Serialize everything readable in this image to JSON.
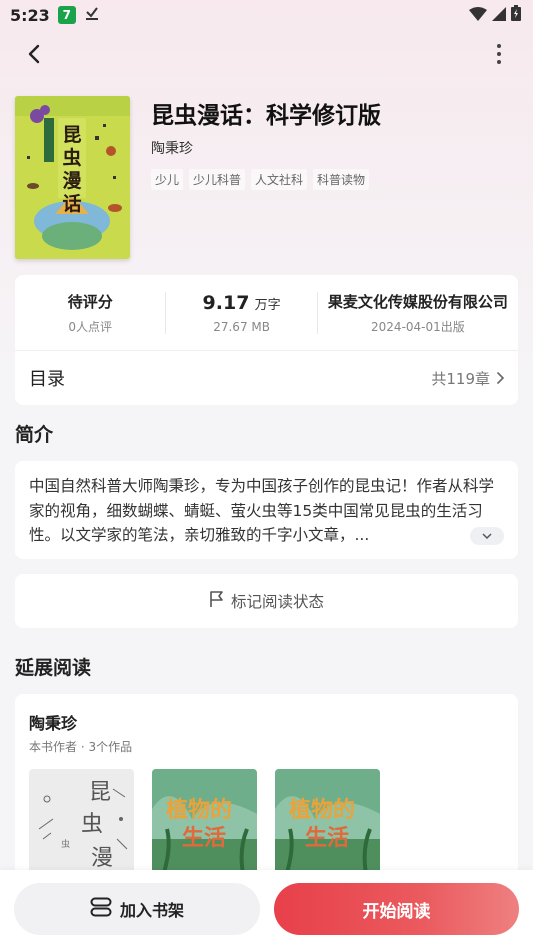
{
  "status_bar": {
    "time": "5:23",
    "app_badge": "7"
  },
  "book": {
    "title": "昆虫漫话：科学修订版",
    "author": "陶秉珍",
    "tags": [
      "少儿",
      "少儿科普",
      "人文社科",
      "科普读物"
    ],
    "cover_text": "昆虫漫话"
  },
  "stats": {
    "rating_label": "待评分",
    "rating_sub": "0人点评",
    "word_count": "9.17",
    "word_unit": "万字",
    "file_size": "27.67 MB",
    "publisher": "果麦文化传媒股份有限公司",
    "publish_date": "2024-04-01出版"
  },
  "toc": {
    "label": "目录",
    "count": "共119章"
  },
  "intro": {
    "section_title": "简介",
    "text": "中国自然科普大师陶秉珍，专为中国孩子创作的昆虫记！作者从科学家的视角，细数蝴蝶、蜻蜓、萤火虫等15类中国常见昆虫的生活习性。以文学家的笔法，亲切雅致的千字小文章，..."
  },
  "mark_status_label": "标记阅读状态",
  "extended": {
    "section_title": "延展阅读",
    "author": "陶秉珍",
    "subtitle": "本书作者 · 3个作品",
    "books": [
      {
        "cover_text": "昆虫漫",
        "style": "sketch"
      },
      {
        "cover_text": "植物的生活",
        "style": "plant"
      },
      {
        "cover_text": "植物的生活",
        "style": "plant"
      }
    ]
  },
  "bottom": {
    "shelf_label": "加入书架",
    "read_label": "开始阅读"
  },
  "colors": {
    "accent": "#e8404a",
    "cover_bg": "#c7d94a"
  }
}
